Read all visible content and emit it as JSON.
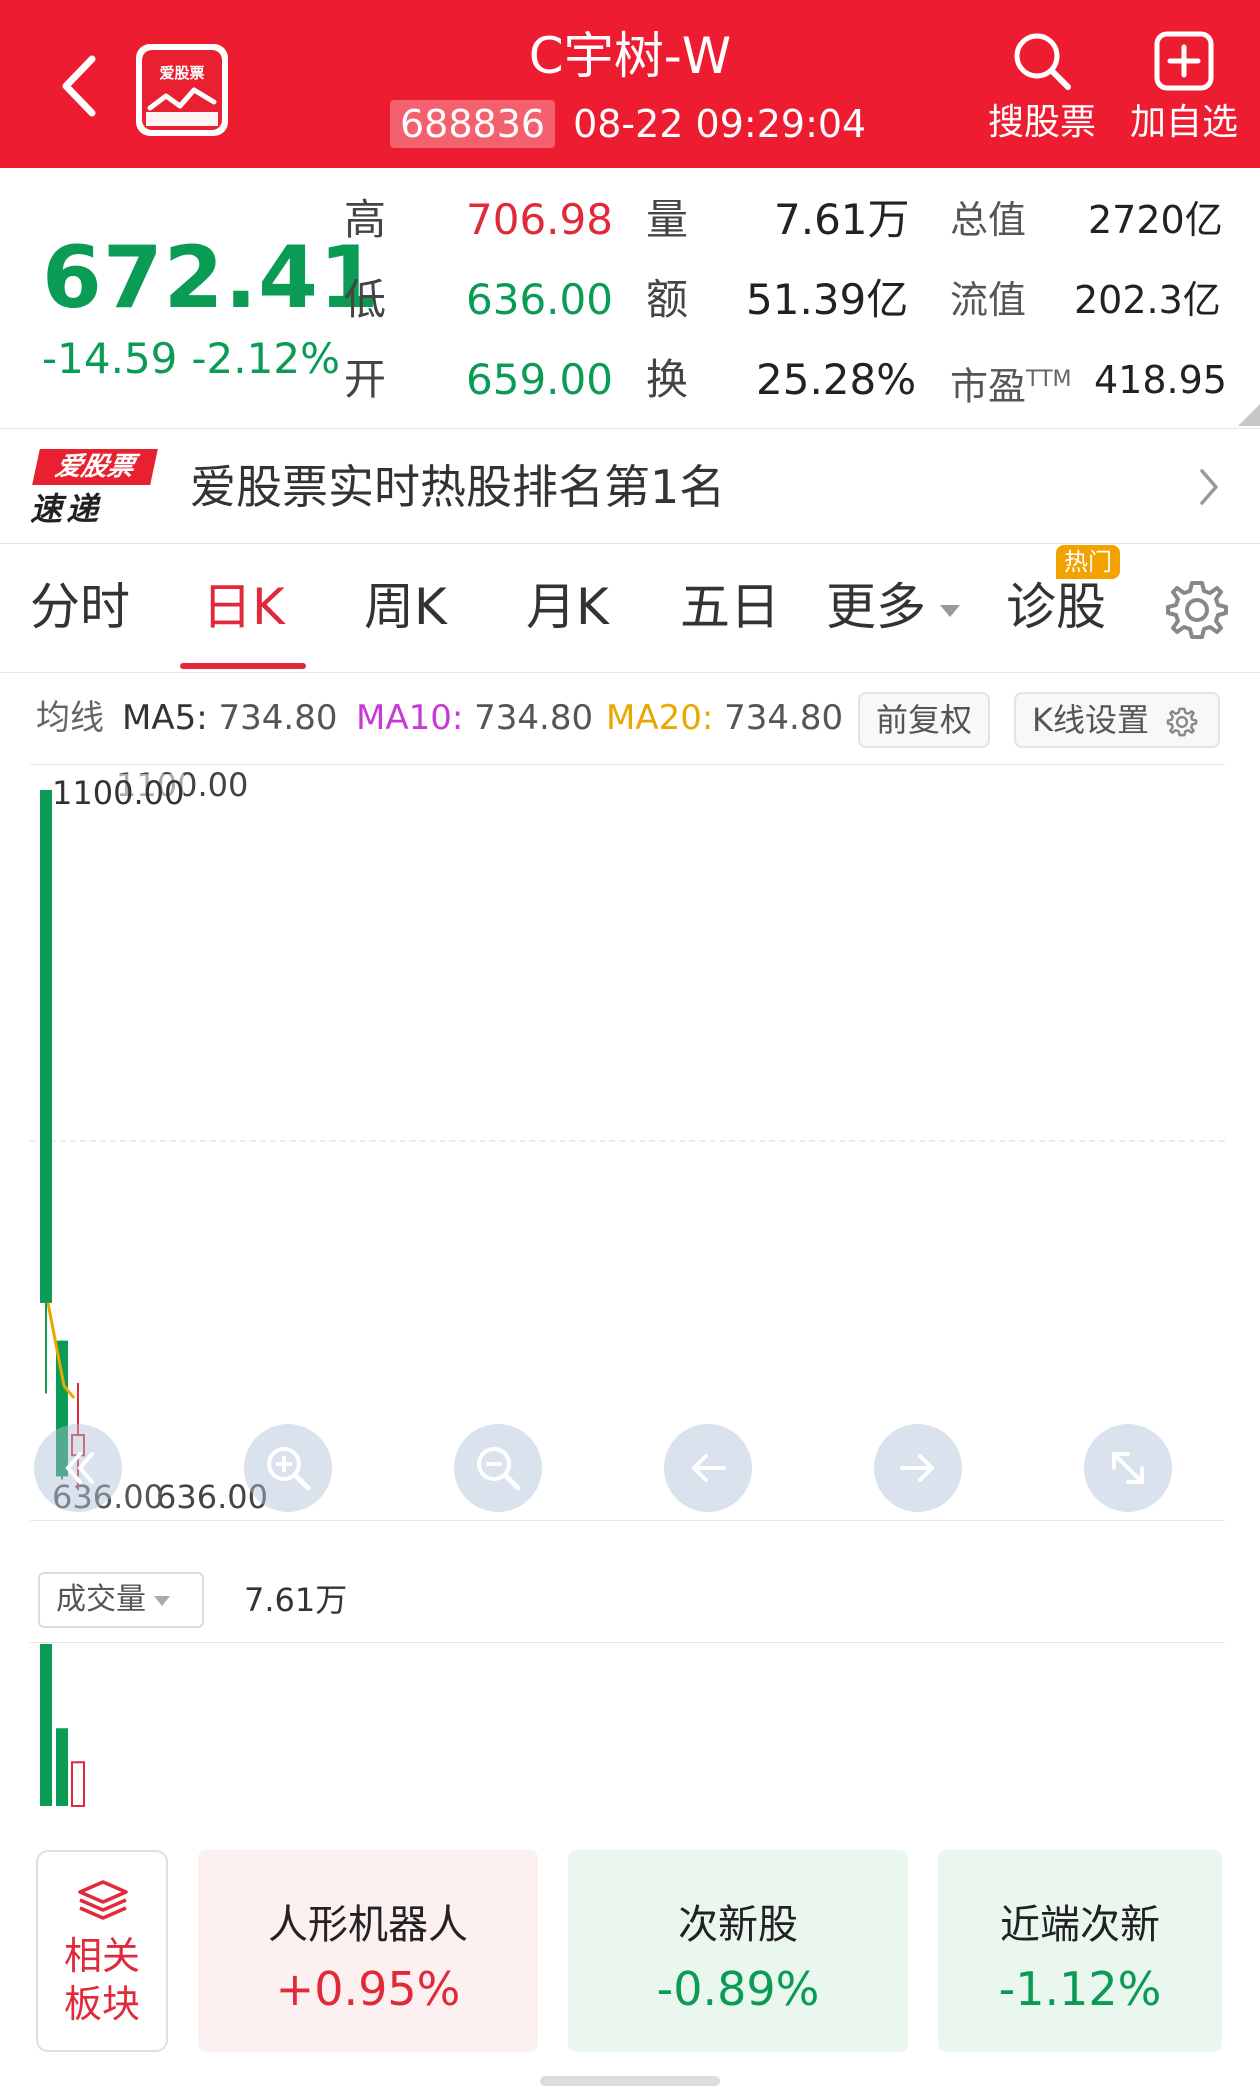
{
  "header": {
    "title": "C宇树-W",
    "code": "688836",
    "datetime": "08-22 09:29:04",
    "logo_text": "爱股票",
    "search_label": "搜股票",
    "add_label": "加自选",
    "bg_color": "#ee1c30"
  },
  "quote": {
    "price": "672.41",
    "change": "-14.59",
    "change_pct": "-2.12%",
    "high_label": "高",
    "high": "706.98",
    "low_label": "低",
    "low": "636.00",
    "open_label": "开",
    "open": "659.00",
    "volume_label": "量",
    "volume": "7.61万",
    "amount_label": "额",
    "amount": "51.39亿",
    "turnover_label": "换",
    "turnover": "25.28%",
    "mktcap_label": "总值",
    "mktcap": "2720亿",
    "float_label": "流值",
    "float_cap": "202.3亿",
    "pe_label": "市盈",
    "pe_sup": "TTM",
    "pe": "418.95",
    "up_color": "#e02a3a",
    "down_color": "#0a9b54"
  },
  "banner": {
    "logo_top": "爱股票",
    "logo_bottom": "速递",
    "text": "爱股票实时热股排名第1名"
  },
  "tabs": {
    "items": [
      "分时",
      "日K",
      "周K",
      "月K",
      "五日",
      "更多",
      "诊股"
    ],
    "active": "日K",
    "hot_badge": "热门"
  },
  "ma": {
    "label": "均线",
    "ma5_label": "MA5:",
    "ma5": "734.80",
    "ma10_label": "MA10:",
    "ma10": "734.80",
    "ma20_label": "MA20:",
    "ma20": "734.80",
    "fuquan_label": "前复权",
    "kline_settings_label": "K线设置"
  },
  "chart_data": {
    "type": "candlestick",
    "y_axis_top_label": "1100.00",
    "y_axis_top_ghost": "1100.00",
    "y_axis_bottom_label": "636.00",
    "y_axis_bottom_ghost": "636.00",
    "ylim": [
      636.0,
      1100.0
    ],
    "candles": [
      {
        "open": 1100.0,
        "close": 760.0,
        "high": 1100.0,
        "low": 700.0,
        "direction": "down"
      },
      {
        "open": 735.0,
        "close": 645.0,
        "high": 735.0,
        "low": 643.0,
        "direction": "down"
      },
      {
        "open": 659.0,
        "close": 672.41,
        "high": 706.98,
        "low": 636.0,
        "direction": "up"
      }
    ],
    "ma_line": [
      760.0,
      705.0
    ],
    "volume_label": "成交量",
    "volume_value": "7.61万",
    "volumes": [
      1.0,
      0.48,
      0.27
    ]
  },
  "sectors": {
    "related_label": "相关板块",
    "items": [
      {
        "name": "人形机器人",
        "pct": "+0.95%"
      },
      {
        "name": "次新股",
        "pct": "-0.89%"
      },
      {
        "name": "近端次新",
        "pct": "-1.12%"
      }
    ]
  }
}
